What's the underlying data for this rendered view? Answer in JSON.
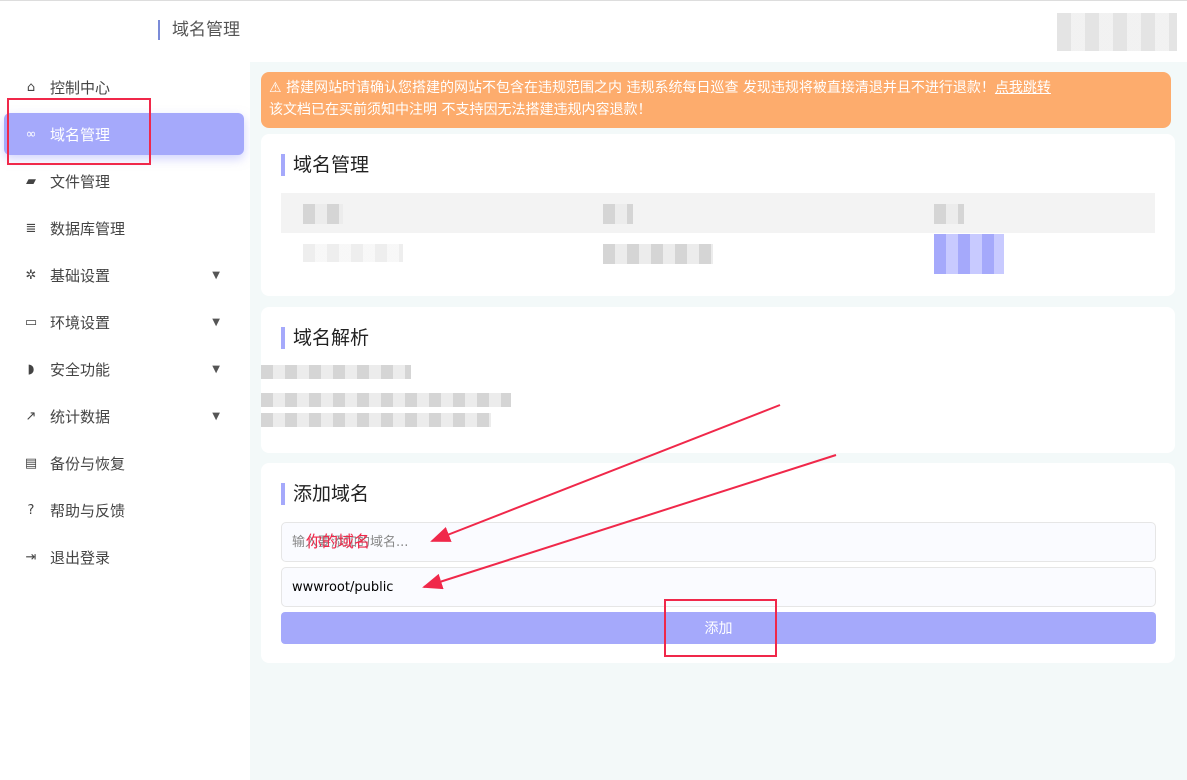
{
  "header": {
    "title": "域名管理"
  },
  "sidebar": {
    "items": [
      {
        "label": "控制中心",
        "icon": "home-icon",
        "glyph": "⌂"
      },
      {
        "label": "域名管理",
        "icon": "link-icon",
        "glyph": "∞",
        "active": true
      },
      {
        "label": "文件管理",
        "icon": "folder-icon",
        "glyph": "▰"
      },
      {
        "label": "数据库管理",
        "icon": "database-icon",
        "glyph": "≣"
      },
      {
        "label": "基础设置",
        "icon": "gear-icon",
        "glyph": "✲",
        "caret": true
      },
      {
        "label": "环境设置",
        "icon": "inbox-icon",
        "glyph": "▭",
        "caret": true
      },
      {
        "label": "安全功能",
        "icon": "shield-icon",
        "glyph": "◗",
        "caret": true
      },
      {
        "label": "统计数据",
        "icon": "chart-icon",
        "glyph": "↗",
        "caret": true
      },
      {
        "label": "备份与恢复",
        "icon": "archive-icon",
        "glyph": "▤"
      },
      {
        "label": "帮助与反馈",
        "icon": "help-icon",
        "glyph": "?"
      },
      {
        "label": "退出登录",
        "icon": "logout-icon",
        "glyph": "⇥"
      }
    ]
  },
  "alert": {
    "text": "搭建网站时请确认您搭建的网站不包含在违规范围之内 违规系统每日巡查 发现违规将被直接清退并且不进行退款！",
    "link": "点我跳转",
    "text2": "该文档已在买前须知中注明 不支持因无法搭建违规内容退款！"
  },
  "domain_card": {
    "title": "域名管理"
  },
  "dns_card": {
    "title": "域名解析"
  },
  "add_card": {
    "title": "添加域名",
    "domain_placeholder": "输入要添加的域名...",
    "path_value": "wwwroot/public",
    "add_label": "添加"
  },
  "annotation": {
    "text": "你的域名"
  },
  "colors": {
    "accent": "#a5a9fb",
    "alert": "#fdac6d",
    "annotation": "#f0284a"
  }
}
